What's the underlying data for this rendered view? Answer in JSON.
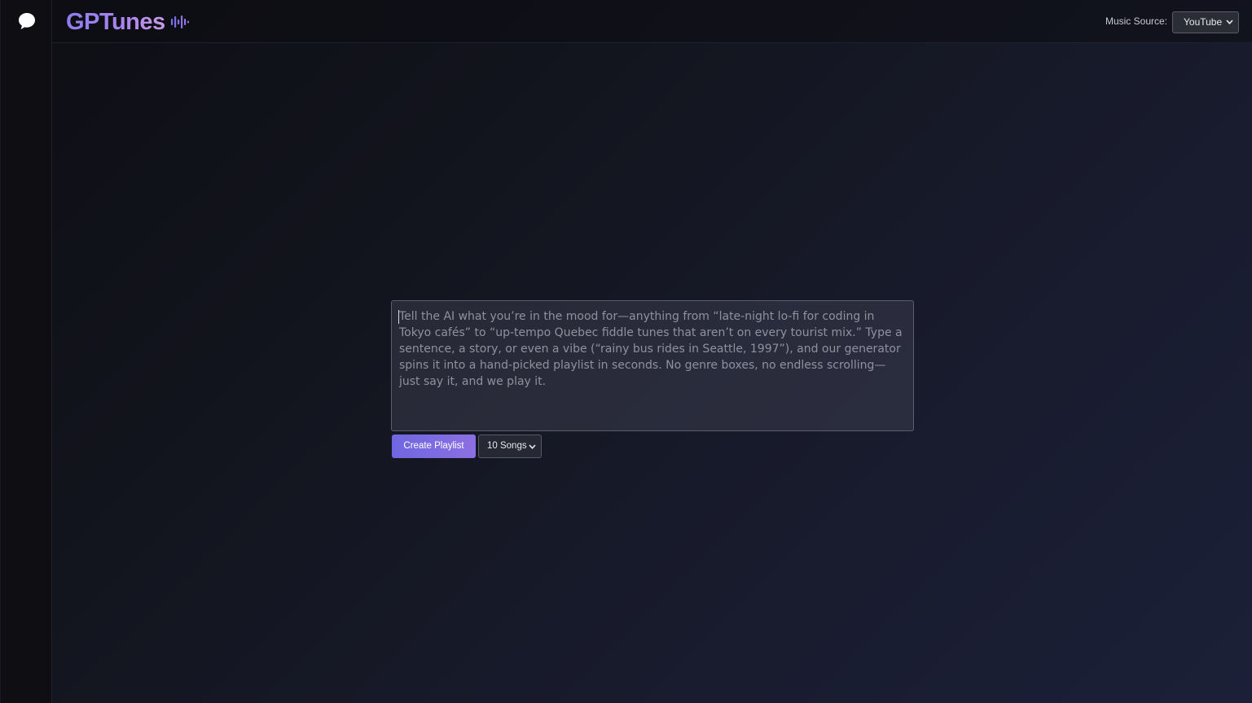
{
  "sidebar": {
    "chat_icon": "chat-bubble-icon"
  },
  "header": {
    "brand": "GPTunes",
    "brand_icon": "audio-wave-icon",
    "source_label": "Music Source:",
    "source_value": "YouTube"
  },
  "composer": {
    "placeholder": "Tell the AI what you’re in the mood for—anything from “late-night lo-fi for coding in Tokyo cafés” to “up-tempo Quebec fiddle tunes that aren’t on every tourist mix.” Type a sentence, a story, or even a vibe (“rainy bus rides in Seattle, 1997”), and our generator spins it into a hand-picked playlist in seconds. No genre boxes, no endless scrolling—just say it, and we play it.",
    "create_label": "Create Playlist",
    "count_value": "10 Songs"
  },
  "colors": {
    "brand_start": "#8d7df0",
    "brand_end": "#c79be7",
    "button_start": "#6f67e0",
    "button_end": "#8c6fe2"
  }
}
